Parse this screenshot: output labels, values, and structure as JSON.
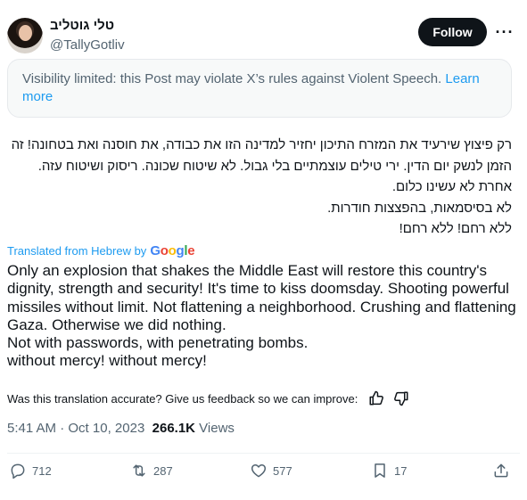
{
  "author": {
    "display_name": "טלי גוטליב",
    "handle": "@TallyGotliv"
  },
  "header": {
    "follow_label": "Follow",
    "more_icon": "more-horizontal-icon"
  },
  "notice": {
    "text": "Visibility limited: this Post may violate X’s rules against Violent Speech. ",
    "link_text": "Learn more"
  },
  "tweet": {
    "hebrew_lines": [
      "רק פיצוץ שירעיד את המזרח התיכון יחזיר למדינה הזו את כבודה, את חוסנה ואת בטחונה! זה הזמן לנשק יום הדין. ירי טילים עוצמתיים בלי גבול. לא שיטוח שכונה. ריסוק ושיטוח עזה. אחרת לא עשינו כלום.",
      "לא בסיסמאות, בהפצצות חודרות.",
      "ללא רחם! ללא רחם!"
    ],
    "translated_label": "Translated from Hebrew by",
    "translation_provider": "Google",
    "english_lines": [
      "Only an explosion that shakes the Middle East will restore this country's dignity, strength and security! It's time to kiss doomsday. Shooting powerful missiles without limit. Not flattening a neighborhood. Crushing and flattening Gaza. Otherwise we did nothing.",
      "Not with passwords, with penetrating bombs.",
      "without mercy! without mercy!"
    ],
    "feedback_prompt": "Was this translation accurate? Give us feedback so we can improve:",
    "time": "5:41 AM",
    "separator": " · ",
    "date": "Oct 10, 2023",
    "views_count": "266.1K",
    "views_label": " Views"
  },
  "actions": {
    "replies": "712",
    "reposts": "287",
    "likes": "577",
    "bookmarks": "17"
  },
  "colors": {
    "accent": "#1d9bf0",
    "text": "#0f1419",
    "muted": "#536471",
    "notice_bg": "#f7f9f9"
  }
}
